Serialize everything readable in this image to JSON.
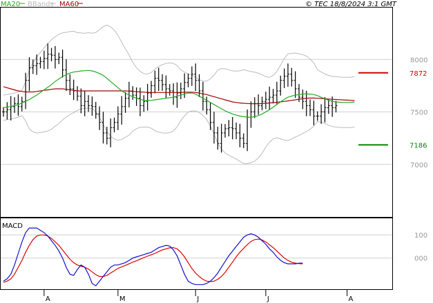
{
  "chart_data": {
    "type": "line",
    "header": {
      "legend": [
        {
          "name": "MA20",
          "color": "#22aa22"
        },
        {
          "name": "BBands",
          "color": "#bbbbbb"
        },
        {
          "name": "MA60",
          "color": "#a00000"
        }
      ],
      "copyright": "© TEC 18/8/2024 3:1 GMT"
    },
    "price_panel": {
      "y_ticks": [
        {
          "value": 8000,
          "label": "8000"
        },
        {
          "value": 7500,
          "label": "7500"
        },
        {
          "value": 7000,
          "label": "7000"
        }
      ],
      "ylim": [
        6500,
        8500
      ],
      "levels": [
        {
          "value": 7872,
          "label": "7872",
          "color": "#cc0000"
        },
        {
          "value": 7186,
          "label": "7186",
          "color": "#008800"
        }
      ]
    },
    "macd_panel": {
      "title": "MACD",
      "y_ticks": [
        {
          "value": 100,
          "label": "100"
        },
        {
          "value": 0,
          "label": "000"
        }
      ],
      "ylim": [
        -135,
        175
      ]
    },
    "x_ticks": [
      {
        "index": 11,
        "label": "A"
      },
      {
        "index": 31,
        "label": "M"
      },
      {
        "index": 52,
        "label": "J"
      },
      {
        "index": 71,
        "label": "J"
      },
      {
        "index": 93,
        "label": "A"
      }
    ],
    "series": [
      {
        "name": "MA20",
        "color": "#22aa22",
        "values": [
          7540,
          7545,
          7552,
          7560,
          7570,
          7585,
          7600,
          7618,
          7640,
          7660,
          7685,
          7710,
          7735,
          7760,
          7790,
          7815,
          7838,
          7855,
          7870,
          7880,
          7885,
          7890,
          7892,
          7895,
          7890,
          7880,
          7865,
          7848,
          7820,
          7790,
          7760,
          7730,
          7700,
          7680,
          7660,
          7645,
          7630,
          7620,
          7610,
          7608,
          7610,
          7615,
          7620,
          7625,
          7630,
          7635,
          7640,
          7650,
          7660,
          7670,
          7680,
          7680,
          7670,
          7650,
          7630,
          7610,
          7590,
          7570,
          7550,
          7530,
          7510,
          7495,
          7480,
          7470,
          7460,
          7455,
          7450,
          7450,
          7455,
          7465,
          7480,
          7500,
          7520,
          7545,
          7570,
          7595,
          7620,
          7640,
          7650,
          7660,
          7665,
          7670,
          7672,
          7670,
          7665,
          7655,
          7640,
          7625,
          7610,
          7600,
          7595,
          7592,
          7590,
          7590,
          7590,
          7595
        ]
      },
      {
        "name": "MA60",
        "color": "#a00000",
        "values": [
          7740,
          7730,
          7720,
          7710,
          7700,
          7695,
          7690,
          7690,
          7690,
          7695,
          7700,
          7705,
          7710,
          7715,
          7720,
          7720,
          7720,
          7715,
          7710,
          7705,
          7700,
          7700,
          7700,
          7700,
          7700,
          7700,
          7700,
          7700,
          7700,
          7700,
          7700,
          7700,
          7700,
          7700,
          7698,
          7695,
          7692,
          7690,
          7688,
          7686,
          7685,
          7685,
          7685,
          7685,
          7685,
          7685,
          7685,
          7685,
          7686,
          7687,
          7688,
          7688,
          7685,
          7680,
          7672,
          7665,
          7655,
          7645,
          7635,
          7625,
          7615,
          7605,
          7595,
          7590,
          7585,
          7582,
          7580,
          7578,
          7578,
          7578,
          7580,
          7582,
          7585,
          7588,
          7592,
          7596,
          7600,
          7605,
          7610,
          7615,
          7620,
          7625,
          7630,
          7632,
          7632,
          7630,
          7628,
          7625,
          7622,
          7620,
          7618,
          7616,
          7614,
          7612,
          7610,
          7608
        ]
      },
      {
        "name": "MACD",
        "color": "#1010cc",
        "values": [
          -100,
          -90,
          -70,
          -30,
          20,
          70,
          110,
          130,
          130,
          130,
          120,
          110,
          95,
          75,
          55,
          30,
          0,
          -40,
          -70,
          -75,
          -50,
          -30,
          -40,
          -70,
          -110,
          -120,
          -100,
          -80,
          -60,
          -40,
          -30,
          -30,
          -25,
          -20,
          -10,
          0,
          5,
          10,
          15,
          20,
          25,
          35,
          45,
          50,
          55,
          52,
          35,
          10,
          -30,
          -70,
          -100,
          -110,
          -115,
          -115,
          -115,
          -110,
          -100,
          -85,
          -65,
          -40,
          -15,
          10,
          30,
          50,
          70,
          90,
          100,
          105,
          100,
          90,
          75,
          60,
          40,
          25,
          5,
          -10,
          -20,
          -25,
          -25,
          -25,
          -22,
          -22
        ]
      },
      {
        "name": "MACD Signal",
        "color": "#dd0000",
        "values": [
          -105,
          -100,
          -90,
          -70,
          -40,
          -10,
          25,
          55,
          80,
          95,
          100,
          100,
          95,
          85,
          70,
          55,
          35,
          15,
          -5,
          -20,
          -30,
          -35,
          -40,
          -48,
          -60,
          -72,
          -80,
          -80,
          -75,
          -65,
          -55,
          -45,
          -38,
          -32,
          -25,
          -18,
          -12,
          -5,
          2,
          8,
          14,
          20,
          28,
          35,
          40,
          44,
          45,
          40,
          25,
          5,
          -20,
          -45,
          -65,
          -80,
          -92,
          -100,
          -102,
          -100,
          -92,
          -80,
          -62,
          -40,
          -18,
          5,
          25,
          42,
          58,
          72,
          80,
          82,
          78,
          70,
          58,
          45,
          30,
          15,
          0,
          -10,
          -18,
          -22,
          -24,
          -25
        ]
      },
      {
        "name": "OHLC",
        "color": "#000000",
        "values": [
          7500,
          7520,
          7550,
          7580,
          7550,
          7600,
          7800,
          7920,
          7940,
          7960,
          7980,
          8010,
          8050,
          8040,
          8000,
          8020,
          7900,
          7800,
          7720,
          7700,
          7650,
          7560,
          7600,
          7560,
          7550,
          7480,
          7400,
          7300,
          7250,
          7350,
          7400,
          7480,
          7550,
          7630,
          7700,
          7660,
          7630,
          7560,
          7600,
          7680,
          7750,
          7820,
          7800,
          7760,
          7720,
          7700,
          7640,
          7680,
          7720,
          7780,
          7820,
          7860,
          7800,
          7700,
          7600,
          7520,
          7400,
          7300,
          7200,
          7300,
          7340,
          7350,
          7340,
          7300,
          7250,
          7200,
          7450,
          7500,
          7580,
          7560,
          7600,
          7620,
          7640,
          7660,
          7700,
          7800,
          7840,
          7860,
          7800,
          7720,
          7640,
          7600,
          7560,
          7520,
          7460,
          7460,
          7500,
          7540,
          7560,
          7540,
          7560
        ]
      }
    ]
  }
}
